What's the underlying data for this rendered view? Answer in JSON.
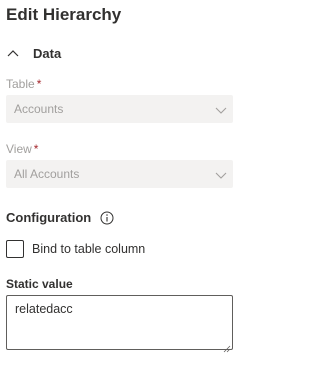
{
  "panel": {
    "title": "Edit Hierarchy"
  },
  "data_section": {
    "label": "Data",
    "expanded": true,
    "icon": "chevron-up-icon"
  },
  "table_field": {
    "label": "Table",
    "required_mark": "*",
    "value": "Accounts",
    "disabled": true,
    "icon": "chevron-down-icon"
  },
  "view_field": {
    "label": "View",
    "required_mark": "*",
    "value": "All Accounts",
    "disabled": true,
    "icon": "chevron-down-icon"
  },
  "configuration": {
    "label": "Configuration",
    "icon": "info-icon"
  },
  "bind_checkbox": {
    "label": "Bind to table column",
    "checked": false
  },
  "static_value": {
    "label": "Static value",
    "value": "relatedacc"
  },
  "colors": {
    "text": "#323130",
    "disabled_text": "#a19f9d",
    "disabled_bg": "#f3f2f1",
    "required": "#a4262c",
    "border": "#605e5c"
  }
}
